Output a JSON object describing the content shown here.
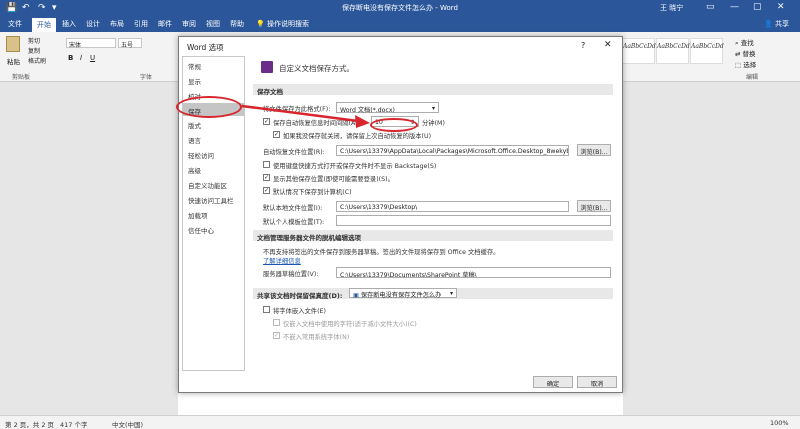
{
  "titlebar": {
    "doc_title": "保存断电没有保存文件怎么办 - Word",
    "user": "王 晓宁",
    "save_icon": "💾",
    "undo_icon": "↶",
    "redo_icon": "↷",
    "customize_icon": "▾",
    "min_icon": "—",
    "max_icon": "▢",
    "close_icon": "✕",
    "ribbon_icon": "▭"
  },
  "tabs": [
    "文件",
    "开始",
    "插入",
    "设计",
    "布局",
    "引用",
    "邮件",
    "审阅",
    "视图",
    "帮助"
  ],
  "tell_me": "操作说明搜索",
  "share": "共享",
  "ribbon": {
    "paste": "粘贴",
    "cut": "剪切",
    "copy": "复制",
    "format_painter": "格式刷",
    "clipboard": "剪贴板",
    "font_name": "宋体",
    "font_size": "五号",
    "font_group": "字体",
    "styles": [
      "AaBbCcDd",
      "AaBbCcDd",
      "AaBbCcDd"
    ],
    "find": "查找",
    "replace": "替换",
    "select": "选择",
    "editing": "编辑"
  },
  "statusbar": {
    "page": "第 2 页，共 2 页",
    "words": "417 个字",
    "lang": "中文(中国)",
    "zoom": "100%"
  },
  "dialog": {
    "title": "Word 选项",
    "help": "?",
    "close": "✕",
    "nav": [
      "常规",
      "显示",
      "校对",
      "保存",
      "版式",
      "语言",
      "轻松访问",
      "高级",
      "自定义功能区",
      "快速访问工具栏",
      "加载项",
      "信任中心"
    ],
    "heading": "自定义文档保存方式。",
    "section_save": "保存文档",
    "save_format_label": "将文件保存为此格式(F):",
    "save_format_value": "Word 文档(*.docx)",
    "autorecover_label": "保存自动恢复信息时间间隔(A)",
    "autorecover_value": "10",
    "autorecover_unit": "分钟(M)",
    "keep_last_label": "如果我没保存就关闭，请保留上次自动恢复的版本(U)",
    "autorecover_path_label": "自动恢复文件位置(R):",
    "autorecover_path_value": "C:\\Users\\13379\\AppData\\Local\\Packages\\Microsoft.Office.Desktop_8wekyb3d",
    "browse": "浏览(B)...",
    "backstage_label": "使用键盘快捷方式打开或保存文件时不显示 Backstage(S)",
    "show_more_label": "显示其他保存位置(即使可能需要登录)(S)。",
    "default_computer_label": "默认情况下保存到计算机(C)",
    "default_local_label": "默认本地文件位置(I):",
    "default_local_value": "C:\\Users\\13379\\Desktop\\",
    "browse2": "浏览(B)...",
    "personal_template_label": "默认个人模板位置(T):",
    "personal_template_value": "",
    "section_server": "文档管理服务器文件的脱机编辑选项",
    "server_note": "不再支持将签出的文件保存到服务器草稿。签出的文件现将保存到 Office 文档缓存。",
    "learn_more": "了解详细信息",
    "server_drafts_label": "服务器草稿位置(V):",
    "server_drafts_value": "C:\\Users\\13379\\Documents\\SharePoint 草稿\\",
    "section_fidelity": "共享该文档时保留保真度(D):",
    "fidelity_doc": "保存断电没有保存文件怎么办",
    "embed_fonts_label": "将字体嵌入文件(E)",
    "embed_used_label": "仅嵌入文档中使用的字符(适于减小文件大小)(C)",
    "no_common_label": "不嵌入常用系统字体(N)",
    "ok": "确定",
    "cancel": "取消",
    "check": "✓"
  },
  "annotation_color": "#d7262d",
  "accent": "#2b579a"
}
